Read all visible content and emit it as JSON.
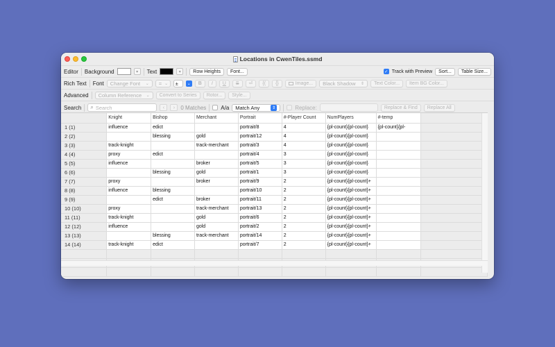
{
  "window": {
    "title": "Locations in CwenTiles.ssmd"
  },
  "editor_row": {
    "label": "Editor",
    "background_label": "Background",
    "text_label": "Text",
    "row_heights_btn": "Row Heights",
    "font_btn": "Font...",
    "track_preview_label": "Track with Preview",
    "track_preview_checked": true,
    "sort_btn": "Sort...",
    "table_size_btn": "Table Size..."
  },
  "rich_row": {
    "label": "Rich Text",
    "font_label": "Font",
    "change_font": "Change Font",
    "size_value": "=",
    "align_value": "±",
    "bold": "B",
    "italic": "I",
    "underline": "U",
    "strike": "S",
    "sym1": "⏎",
    "sym2": "{(",
    "sym3": "{}",
    "image_btn": "Image...",
    "shadow": "Black Shadow",
    "text_color_btn": "Text Color...",
    "item_bg_btn": "Item BG Color..."
  },
  "advanced_row": {
    "label": "Advanced",
    "column_ref": "Column Reference",
    "convert_btn": "Convert to Series",
    "rotor_btn": "Rotor...",
    "style_btn": "Style..."
  },
  "search_row": {
    "label": "Search",
    "placeholder": "Search",
    "matches": "0 Matches",
    "aa_label": "A/a",
    "match_mode": "Match Any",
    "replace_label": "Replace:",
    "replace_find_btn": "Replace & Find",
    "replace_all_btn": "Replace All"
  },
  "table": {
    "columns": [
      "Knight",
      "Bishop",
      "Merchant",
      "Portrait",
      "#-Player Count",
      "NumPlayers",
      "#-temp"
    ],
    "rows": [
      {
        "label": "1 (1)",
        "cells": [
          "influence",
          "edict",
          "",
          "portrait/8",
          "4",
          "{pl-count}{pl-count}",
          "{pl-count}{pl-"
        ]
      },
      {
        "label": "2 (2)",
        "cells": [
          "",
          "blessing",
          "gold",
          "portrait/12",
          "4",
          "{pl-count}{pl-count}",
          ""
        ]
      },
      {
        "label": "3 (3)",
        "cells": [
          "track-knight",
          "",
          "track-merchant",
          "portrait/3",
          "4",
          "{pl-count}{pl-count}",
          ""
        ]
      },
      {
        "label": "4 (4)",
        "cells": [
          "proxy",
          "edict",
          "",
          "portrait/4",
          "3",
          "{pl-count}{pl-count}",
          ""
        ]
      },
      {
        "label": "5 (5)",
        "cells": [
          "influence",
          "",
          "broker",
          "portrait/5",
          "3",
          "{pl-count}{pl-count}",
          ""
        ]
      },
      {
        "label": "6 (6)",
        "cells": [
          "",
          "blessing",
          "gold",
          "portrait/1",
          "3",
          "{pl-count}{pl-count}",
          ""
        ]
      },
      {
        "label": "7 (7)",
        "cells": [
          "proxy",
          "",
          "broker",
          "portrait/9",
          "2",
          "{pl-count}{pl-count}+",
          ""
        ]
      },
      {
        "label": "8 (8)",
        "cells": [
          "influence",
          "blessing",
          "",
          "portrait/10",
          "2",
          "{pl-count}{pl-count}+",
          ""
        ]
      },
      {
        "label": "9 (9)",
        "cells": [
          "",
          "edict",
          "broker",
          "portrait/11",
          "2",
          "{pl-count}{pl-count}+",
          ""
        ]
      },
      {
        "label": "10 (10)",
        "cells": [
          "proxy",
          "",
          "track-merchant",
          "portrait/13",
          "2",
          "{pl-count}{pl-count}+",
          ""
        ]
      },
      {
        "label": "11 (11)",
        "cells": [
          "track-knight",
          "",
          "gold",
          "portrait/6",
          "2",
          "{pl-count}{pl-count}+",
          ""
        ]
      },
      {
        "label": "12 (12)",
        "cells": [
          "influence",
          "",
          "gold",
          "portrait/2",
          "2",
          "{pl-count}{pl-count}+",
          ""
        ]
      },
      {
        "label": "13 (13)",
        "cells": [
          "",
          "blessing",
          "track-merchant",
          "portrait/14",
          "2",
          "{pl-count}{pl-count}+",
          ""
        ]
      },
      {
        "label": "14 (14)",
        "cells": [
          "track-knight",
          "edict",
          "",
          "portrait/7",
          "2",
          "{pl-count}{pl-count}+",
          ""
        ]
      }
    ]
  },
  "colors": {
    "desktop": "#5f6fbc",
    "accent": "#2f7cf6"
  }
}
